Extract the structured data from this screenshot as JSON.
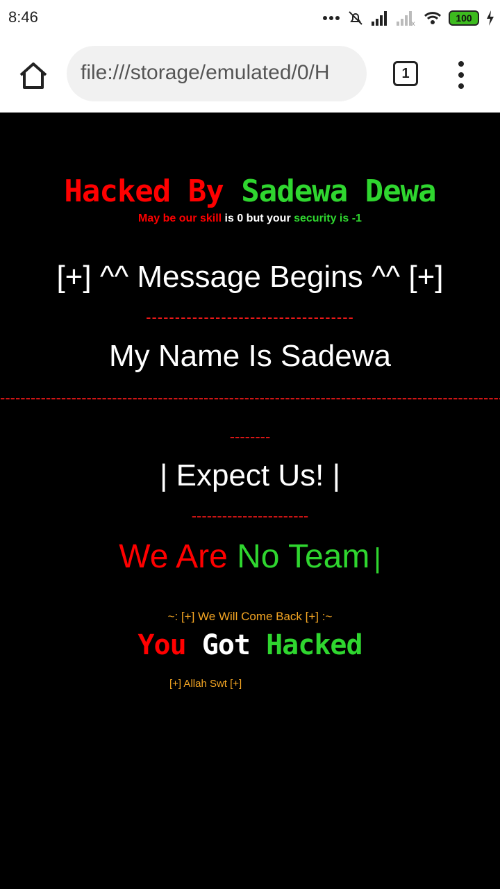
{
  "status_bar": {
    "time": "8:46",
    "battery": "100",
    "icons": [
      "more-dots-icon",
      "mute-bell-icon",
      "signal-icon",
      "signal-none-icon",
      "wifi-icon",
      "battery-icon",
      "charging-icon"
    ]
  },
  "browser": {
    "url": "file:///storage/emulated/0/H",
    "tab_count": "1",
    "icons": [
      "home-icon",
      "tab-switcher-icon",
      "overflow-menu-icon"
    ]
  },
  "page": {
    "title_part1": "Hacked By ",
    "title_part2": "Sadewa Dewa",
    "tagline_part1": "May be our skill",
    "tagline_part2": " is 0 but your ",
    "tagline_part3": "security is -1",
    "message_begins": "[+] ^^ Message Begins ^^ [+]",
    "divider_1": "------------------------------------",
    "name_line": "My Name Is Sadewa",
    "divider_full": "---------------------------------------------------------------------------------------------------",
    "divider_2": "--------",
    "expect_us": "| Expect Us! |",
    "divider_3": "-----------------------",
    "team_part1": "We Are ",
    "team_part2": "No Team",
    "team_cursor": "|",
    "come_back": "~: [+] We Will Come Back [+] :~",
    "got_part1": "You ",
    "got_part2": "Got ",
    "got_part3": "Hacked",
    "allah": "[+] Allah Swt [+]"
  },
  "colors": {
    "background": "#000000",
    "red": "#ff0000",
    "green": "#2fd62f",
    "white": "#ffffff",
    "orange": "#f5a623"
  }
}
